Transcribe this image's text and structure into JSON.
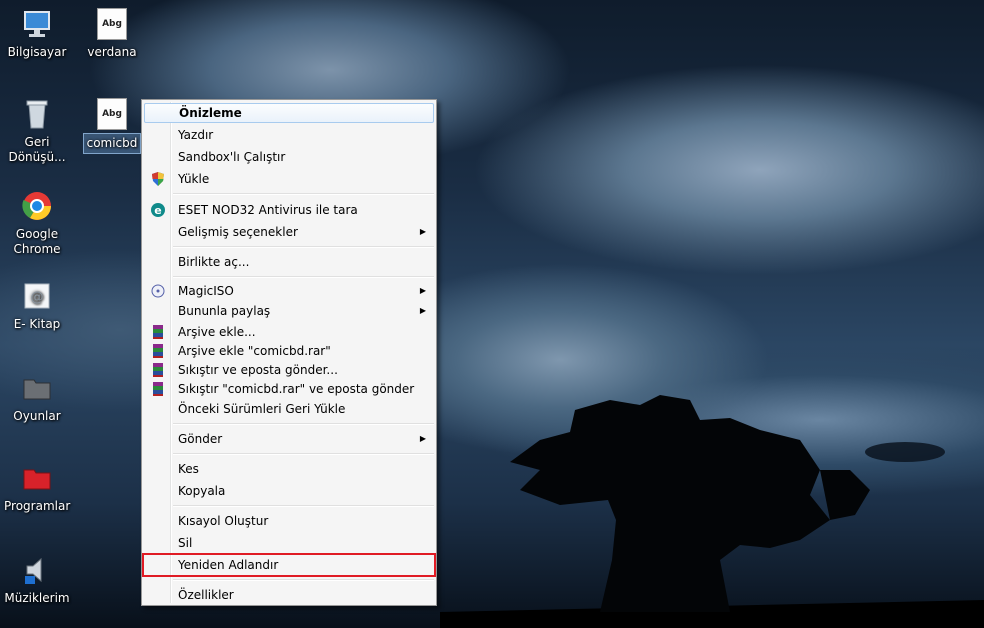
{
  "desktop": {
    "icons": [
      {
        "label": "Bilgisayar",
        "icon": "computer-icon"
      },
      {
        "label": "verdana",
        "icon": "font-file-icon",
        "glyph_text": "Abg"
      },
      {
        "label": "Geri Dönüşü...",
        "icon": "recycle-bin-icon"
      },
      {
        "label": "comicbd",
        "icon": "font-file-icon",
        "glyph_text": "Abg",
        "selected": true
      },
      {
        "label": "Google Chrome",
        "icon": "chrome-icon"
      },
      {
        "label": "E- Kitap",
        "icon": "ebook-icon"
      },
      {
        "label": "Oyunlar",
        "icon": "folder-icon"
      },
      {
        "label": "Programlar",
        "icon": "folder-red-icon"
      },
      {
        "label": "Müziklerim",
        "icon": "music-icon"
      }
    ]
  },
  "context_menu": {
    "items": {
      "preview": "Önizleme",
      "print": "Yazdır",
      "sandbox": "Sandbox'lı Çalıştır",
      "install": "Yükle",
      "eset": "ESET NOD32 Antivirus ile tara",
      "advanced": "Gelişmiş seçenekler",
      "open_with": "Birlikte aç...",
      "magiciso": "MagicISO",
      "share": "Bununla paylaş",
      "add_archive": "Arşive ekle...",
      "add_archive_named": "Arşive ekle \"comicbd.rar\"",
      "compress_email": "Sıkıştır ve eposta gönder...",
      "compress_email_named": "Sıkıştır \"comicbd.rar\" ve eposta gönder",
      "restore": "Önceki Sürümleri Geri Yükle",
      "send_to": "Gönder",
      "cut": "Kes",
      "copy": "Kopyala",
      "shortcut": "Kısayol Oluştur",
      "delete": "Sil",
      "rename": "Yeniden Adlandır",
      "properties": "Özellikler"
    },
    "highlighted_item": "preview",
    "outlined_item": "rename",
    "colors": {
      "outline": "#e01b24",
      "highlight_border": "#a8cbee"
    }
  }
}
